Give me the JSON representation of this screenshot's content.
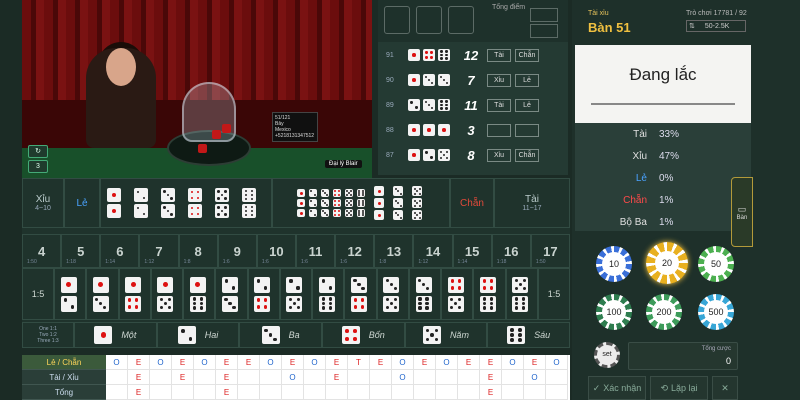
{
  "video": {
    "dealer_card": [
      "51/121",
      "Bảy",
      "Mexico",
      "+5218131347512"
    ],
    "dealer_badge": "Đại lý Blair",
    "ctrl_refresh": "↻",
    "ctrl_signal": "3"
  },
  "history": {
    "title": "Tổng điểm",
    "rows": [
      {
        "id": "91",
        "dice": [
          1,
          4,
          6
        ],
        "sum": "12",
        "t1": "Tài",
        "t2": "Chẵn"
      },
      {
        "id": "90",
        "dice": [
          1,
          3,
          3
        ],
        "sum": "7",
        "t1": "Xỉu",
        "t2": "Lẻ"
      },
      {
        "id": "89",
        "dice": [
          2,
          3,
          6
        ],
        "sum": "11",
        "t1": "Tài",
        "t2": "Lẻ"
      },
      {
        "id": "88",
        "dice": [
          1,
          1,
          1
        ],
        "sum": "3",
        "t1": "",
        "t2": ""
      },
      {
        "id": "87",
        "dice": [
          1,
          2,
          5
        ],
        "sum": "8",
        "t1": "Xỉu",
        "t2": "Chẵn"
      }
    ]
  },
  "board": {
    "xiu": "Xỉu",
    "xiu_range": "4~10",
    "le": "Lẻ",
    "chan": "Chẵn",
    "tai": "Tài",
    "tai_range": "11~17",
    "totals": [
      {
        "n": "4",
        "p": "1:50"
      },
      {
        "n": "5",
        "p": "1:18"
      },
      {
        "n": "6",
        "p": "1:14"
      },
      {
        "n": "7",
        "p": "1:12"
      },
      {
        "n": "8",
        "p": "1:8"
      },
      {
        "n": "9",
        "p": "1:6"
      },
      {
        "n": "10",
        "p": "1:6"
      },
      {
        "n": "11",
        "p": "1:6"
      },
      {
        "n": "12",
        "p": "1:6"
      },
      {
        "n": "13",
        "p": "1:8"
      },
      {
        "n": "14",
        "p": "1:12"
      },
      {
        "n": "15",
        "p": "1:14"
      },
      {
        "n": "16",
        "p": "1:18"
      },
      {
        "n": "17",
        "p": "1:50"
      }
    ],
    "pair_ratio": "1:5",
    "singles_odds": [
      "One 1:1",
      "Two 1:2",
      "Three 1:3"
    ],
    "singles": [
      "Một",
      "Hai",
      "Ba",
      "Bốn",
      "Năm",
      "Sáu"
    ]
  },
  "roadmap": {
    "rows": [
      "Lẻ / Chẵn",
      "Tài / Xỉu",
      "Tổng"
    ],
    "row1": [
      "O",
      "E",
      "O",
      "E",
      "O",
      "E",
      "E",
      "O",
      "E",
      "O",
      "E",
      "T",
      "E",
      "O",
      "E",
      "O",
      "E",
      "E",
      "O",
      "E",
      "O",
      "E"
    ],
    "row2": [
      "",
      "E",
      "",
      "E",
      "",
      "E",
      "",
      "",
      "O",
      "",
      "E",
      "",
      "",
      "O",
      "",
      "",
      "",
      "E",
      "",
      "O",
      ""
    ],
    "row3": [
      "",
      "E",
      "",
      "",
      "",
      "E",
      "",
      "",
      "",
      "",
      "",
      "",
      "",
      "",
      "",
      "",
      "",
      "E",
      "",
      "",
      ""
    ]
  },
  "right": {
    "table_label": "Tài xỉu",
    "table_name": "Bàn 51",
    "game_id": "Trò chơi 17781 / 92",
    "limit": "50-2.5K",
    "status": "Đang lắc",
    "stats": [
      {
        "k": "Tài",
        "v": "33%",
        "c": "#e0e0e0"
      },
      {
        "k": "Xỉu",
        "v": "47%",
        "c": "#e0e0e0"
      },
      {
        "k": "Lẻ",
        "v": "0%",
        "c": "#4aa3ff"
      },
      {
        "k": "Chẵn",
        "v": "1%",
        "c": "#ff4a4a"
      },
      {
        "k": "Bộ Ba",
        "v": "1%",
        "c": "#e0e0e0"
      }
    ],
    "chips": [
      "10",
      "20",
      "50",
      "100",
      "200",
      "500"
    ],
    "set_label": "set",
    "total_label": "Tổng cược",
    "total_value": "0",
    "confirm": "Xác nhận",
    "rebet": "Lặp lại",
    "close": "✕",
    "menu_tab": "Bàn"
  }
}
